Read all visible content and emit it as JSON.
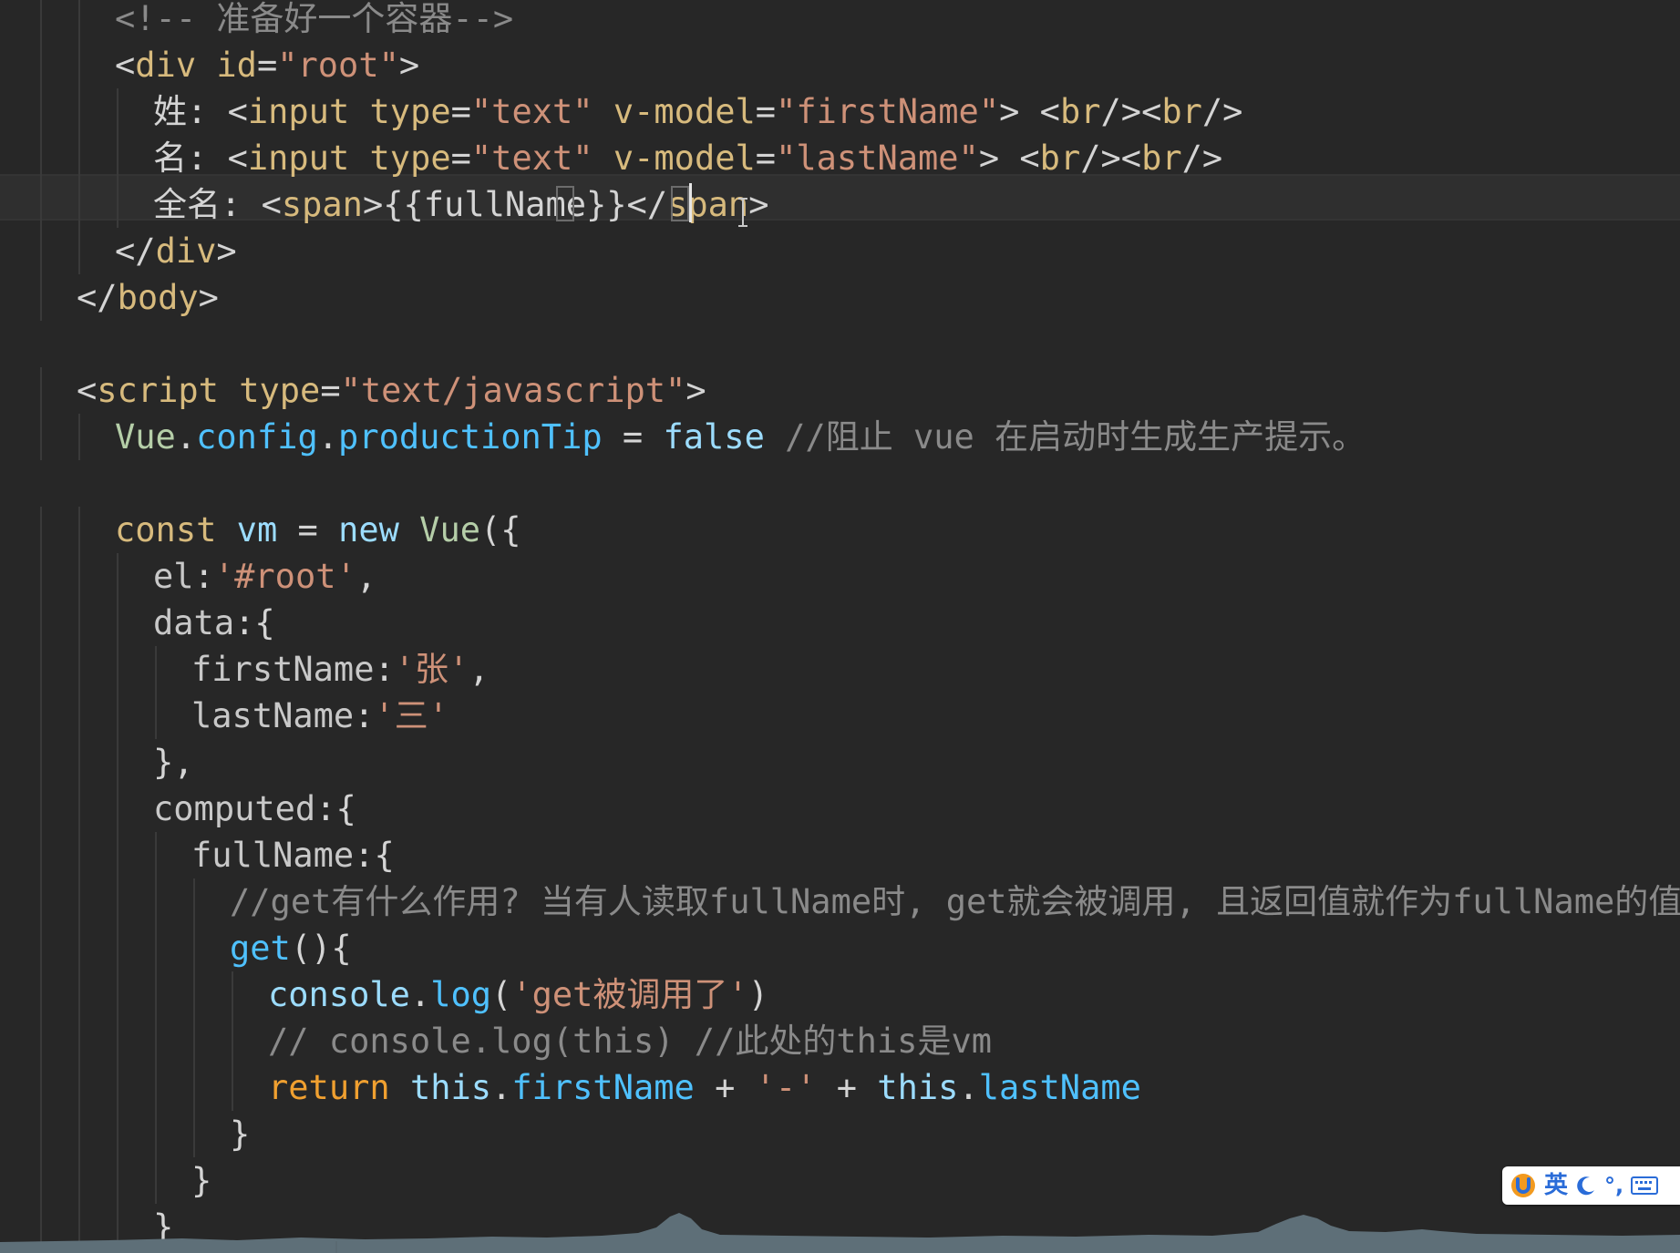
{
  "editor": {
    "lines": [
      [
        [
          "c-cmt",
          "<!-- 准备好一个容器-->"
        ]
      ],
      [
        [
          "c-pun",
          "<"
        ],
        [
          "c-tag",
          "div"
        ],
        [
          "c-pln",
          " "
        ],
        [
          "c-att",
          "id"
        ],
        [
          "c-pln",
          "="
        ],
        [
          "c-str",
          "\"root\""
        ],
        [
          "c-pun",
          ">"
        ]
      ],
      [
        [
          "c-pln",
          "姓: "
        ],
        [
          "c-pun",
          "<"
        ],
        [
          "c-tag",
          "input"
        ],
        [
          "c-pln",
          " "
        ],
        [
          "c-att",
          "type"
        ],
        [
          "c-pln",
          "="
        ],
        [
          "c-str",
          "\"text\""
        ],
        [
          "c-pln",
          " "
        ],
        [
          "c-att",
          "v-model"
        ],
        [
          "c-pln",
          "="
        ],
        [
          "c-str",
          "\"firstName\""
        ],
        [
          "c-pun",
          ">"
        ],
        [
          "c-pln",
          " "
        ],
        [
          "c-pun",
          "<"
        ],
        [
          "c-tag",
          "br"
        ],
        [
          "c-pun",
          "/><"
        ],
        [
          "c-tag",
          "br"
        ],
        [
          "c-pun",
          "/>"
        ]
      ],
      [
        [
          "c-pln",
          "名: "
        ],
        [
          "c-pun",
          "<"
        ],
        [
          "c-tag",
          "input"
        ],
        [
          "c-pln",
          " "
        ],
        [
          "c-att",
          "type"
        ],
        [
          "c-pln",
          "="
        ],
        [
          "c-str",
          "\"text\""
        ],
        [
          "c-pln",
          " "
        ],
        [
          "c-att",
          "v-model"
        ],
        [
          "c-pln",
          "="
        ],
        [
          "c-str",
          "\"lastName\""
        ],
        [
          "c-pun",
          ">"
        ],
        [
          "c-pln",
          " "
        ],
        [
          "c-pun",
          "<"
        ],
        [
          "c-tag",
          "br"
        ],
        [
          "c-pun",
          "/><"
        ],
        [
          "c-tag",
          "br"
        ],
        [
          "c-pun",
          "/>"
        ]
      ],
      [
        [
          "c-pln",
          "全名: "
        ],
        [
          "c-pun",
          "<"
        ],
        [
          "c-tag",
          "span"
        ],
        [
          "c-pun",
          ">"
        ],
        [
          "c-pln",
          "{{fullName}}"
        ],
        [
          "c-pun",
          "</"
        ],
        [
          "c-tag",
          "span"
        ],
        [
          "c-pun",
          ">"
        ]
      ],
      [
        [
          "c-pun",
          "</"
        ],
        [
          "c-tag",
          "div"
        ],
        [
          "c-pun",
          ">"
        ]
      ],
      [
        [
          "c-pun",
          "</"
        ],
        [
          "c-tag",
          "body"
        ],
        [
          "c-pun",
          ">"
        ]
      ],
      [],
      [
        [
          "c-pun",
          "<"
        ],
        [
          "c-tag",
          "script"
        ],
        [
          "c-pln",
          " "
        ],
        [
          "c-att",
          "type"
        ],
        [
          "c-pln",
          "="
        ],
        [
          "c-str",
          "\"text/javascript\""
        ],
        [
          "c-pun",
          ">"
        ]
      ],
      [
        [
          "c-cls",
          "Vue"
        ],
        [
          "c-pln",
          "."
        ],
        [
          "c-mem",
          "config"
        ],
        [
          "c-pln",
          "."
        ],
        [
          "c-mem",
          "productionTip"
        ],
        [
          "c-pln",
          " = "
        ],
        [
          "c-bool",
          "false"
        ],
        [
          "c-pln",
          " "
        ],
        [
          "c-cmt",
          "//阻止 vue 在启动时生成生产提示。"
        ]
      ],
      [],
      [
        [
          "c-kw",
          "const"
        ],
        [
          "c-pln",
          " "
        ],
        [
          "c-var",
          "vm"
        ],
        [
          "c-pln",
          " = "
        ],
        [
          "c-new",
          "new"
        ],
        [
          "c-pln",
          " "
        ],
        [
          "c-cls",
          "Vue"
        ],
        [
          "c-pln",
          "({"
        ]
      ],
      [
        [
          "c-key",
          "el"
        ],
        [
          "c-pln",
          ":"
        ],
        [
          "c-str",
          "'#root'"
        ],
        [
          "c-pln",
          ","
        ]
      ],
      [
        [
          "c-key",
          "data"
        ],
        [
          "c-pln",
          ":{"
        ]
      ],
      [
        [
          "c-key",
          "firstName"
        ],
        [
          "c-pln",
          ":"
        ],
        [
          "c-str",
          "'张'"
        ],
        [
          "c-pln",
          ","
        ]
      ],
      [
        [
          "c-key",
          "lastName"
        ],
        [
          "c-pln",
          ":"
        ],
        [
          "c-str",
          "'三'"
        ]
      ],
      [
        [
          "c-pln",
          "},"
        ]
      ],
      [
        [
          "c-key",
          "computed"
        ],
        [
          "c-pln",
          ":{"
        ]
      ],
      [
        [
          "c-key",
          "fullName"
        ],
        [
          "c-pln",
          ":{"
        ]
      ],
      [
        [
          "c-cmt",
          "//get有什么作用? 当有人读取fullName时, get就会被调用, 且返回值就作为fullName的值"
        ]
      ],
      [
        [
          "c-fn",
          "get"
        ],
        [
          "c-pln",
          "(){"
        ]
      ],
      [
        [
          "c-var",
          "console"
        ],
        [
          "c-pln",
          "."
        ],
        [
          "c-fn",
          "log"
        ],
        [
          "c-pln",
          "("
        ],
        [
          "c-str",
          "'get被调用了'"
        ],
        [
          "c-pln",
          ")"
        ]
      ],
      [
        [
          "c-cmt",
          "// console.log(this) //此处的this是vm"
        ]
      ],
      [
        [
          "c-ret",
          "return"
        ],
        [
          "c-pln",
          " "
        ],
        [
          "c-this",
          "this"
        ],
        [
          "c-pln",
          "."
        ],
        [
          "c-mem",
          "firstName"
        ],
        [
          "c-pln",
          " + "
        ],
        [
          "c-str",
          "'-'"
        ],
        [
          "c-pln",
          " + "
        ],
        [
          "c-this",
          "this"
        ],
        [
          "c-pln",
          "."
        ],
        [
          "c-mem",
          "lastName"
        ]
      ],
      [
        [
          "c-pln",
          "}"
        ]
      ],
      [
        [
          "c-pln",
          "}"
        ]
      ],
      [
        [
          "c-pln",
          "}"
        ]
      ]
    ]
  },
  "colors": {
    "c-cmt": "#8a8a8a",
    "c-pun": "#d4d4d4",
    "c-tag": "#d7ba7d",
    "c-att": "#d7ba7d",
    "c-str": "#ce9178",
    "c-pln": "#d4d4d4",
    "c-kw": "#d7ba7d",
    "c-var": "#9cdcfe",
    "c-new": "#9cdcfe",
    "c-cls": "#b5cea8",
    "c-mem": "#4fc1ff",
    "c-bool": "#9cdcfe",
    "c-key": "#c8c8c8",
    "c-fn": "#4fc1ff",
    "c-ret": "#f0a030",
    "c-this": "#9cdcfe"
  },
  "ime": {
    "language": "英",
    "punctuation": "°,",
    "icons": [
      "sogou-logo-icon",
      "moon-icon",
      "keyboard-icon"
    ]
  }
}
